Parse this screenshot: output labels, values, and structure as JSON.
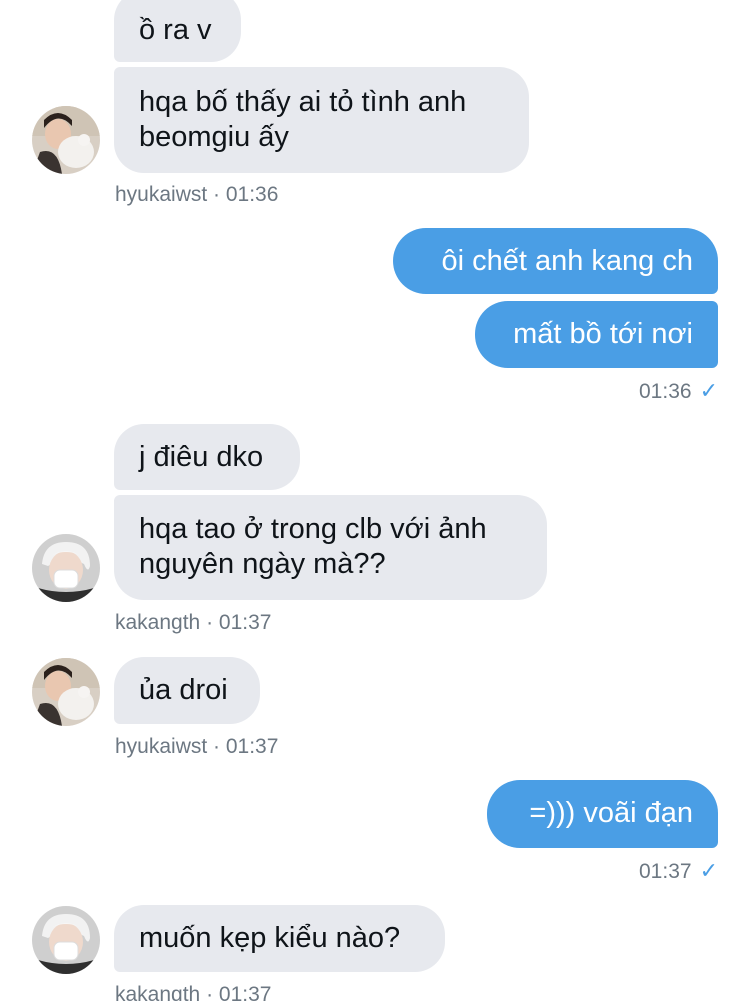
{
  "conversation": {
    "messages": [
      {
        "text": "ồ ra v"
      },
      {
        "lines": [
          "hqa bố thấy ai tỏ tình anh",
          "beomgiu ấy"
        ]
      },
      {
        "text": "ôi chết anh kang ch"
      },
      {
        "text": "mất bồ tới nơi"
      },
      {
        "text": "j điêu dko"
      },
      {
        "lines": [
          "hqa tao ở trong clb với ảnh",
          "nguyên ngày mà??"
        ]
      },
      {
        "text": "ủa droi"
      },
      {
        "text": "=))) voãi đạn"
      },
      {
        "text": "muốn kẹp kiểu nào?"
      }
    ],
    "meta": [
      {
        "text": "hyukaiwst · 01:36"
      },
      {
        "text": "01:36"
      },
      {
        "text": "kakangth · 01:37"
      },
      {
        "text": "hyukaiwst · 01:37"
      },
      {
        "text": "01:37"
      },
      {
        "text": "kakangth · 01:37"
      }
    ],
    "sent_check_glyph": "✓"
  },
  "icons": {
    "read_receipt": "checkmark-icon"
  },
  "colors": {
    "incoming_bubble": "#e7e9ee",
    "outgoing_bubble": "#4a9ee5",
    "meta_text": "#6c7782"
  }
}
